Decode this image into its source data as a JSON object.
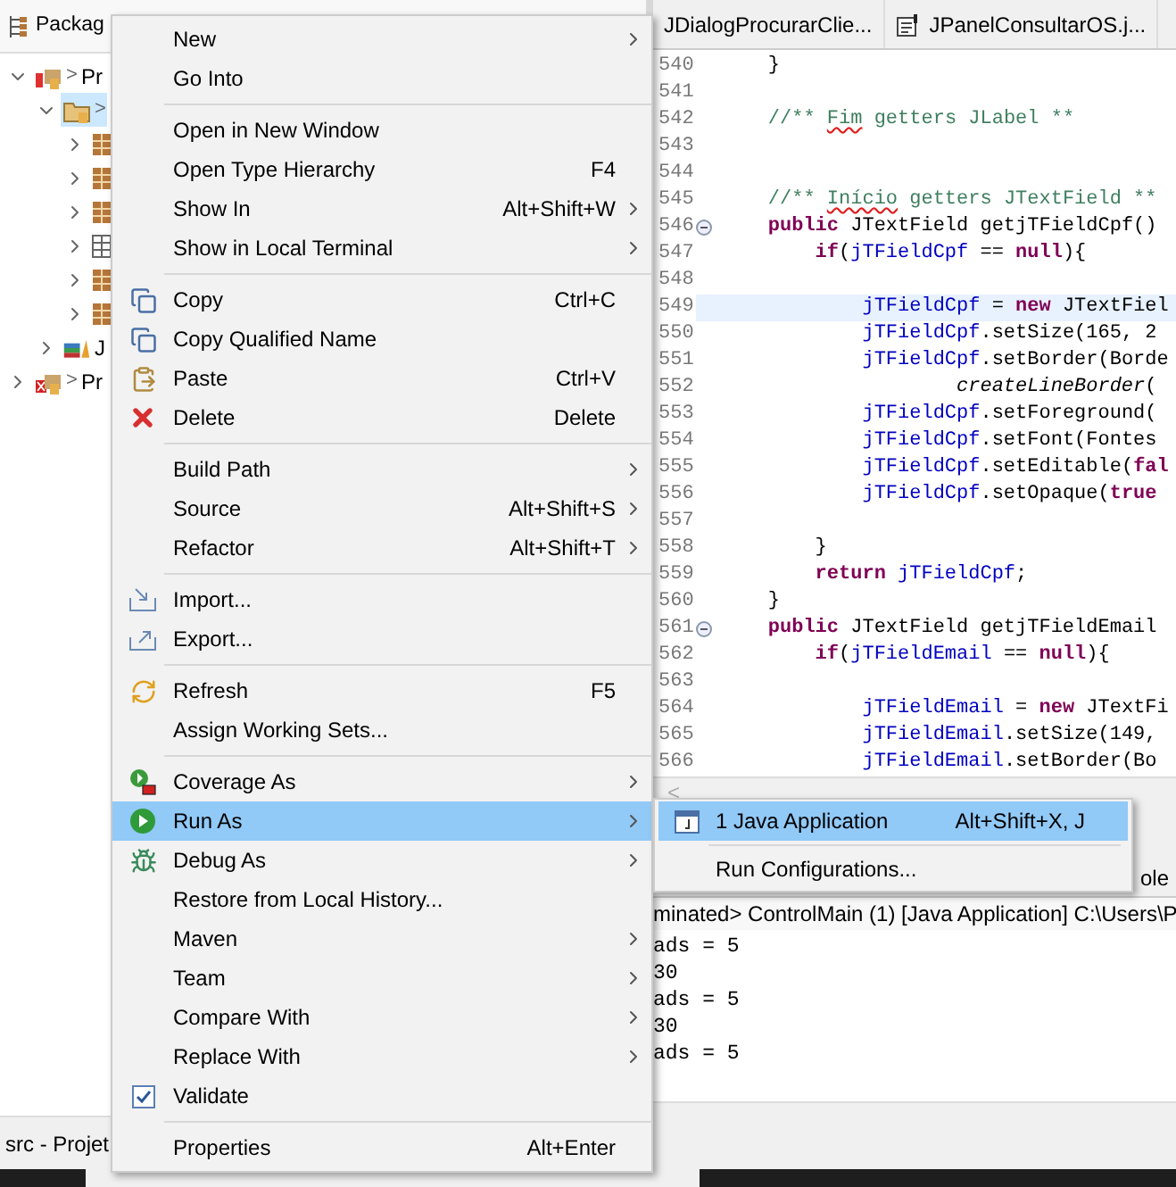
{
  "explorer": {
    "title": "Packag",
    "tree": [
      {
        "prefix": ">",
        "label": "Pr",
        "kind": "project",
        "selected": false,
        "expanded": true,
        "children": [
          {
            "prefix": ">",
            "kind": "package-root",
            "selected": true,
            "expanded": true,
            "children": [
              {
                "kind": "package",
                "selected": false,
                "expanded": false
              },
              {
                "kind": "package",
                "selected": false,
                "expanded": false
              },
              {
                "kind": "package",
                "selected": false,
                "expanded": false
              },
              {
                "kind": "empty-package",
                "selected": false,
                "expanded": false
              },
              {
                "kind": "package",
                "selected": false,
                "expanded": false
              },
              {
                "kind": "package",
                "selected": false,
                "expanded": false
              }
            ]
          },
          {
            "label": "J",
            "kind": "library",
            "selected": false,
            "expanded": false
          }
        ]
      },
      {
        "prefix": ">",
        "label": "Pr",
        "kind": "project-error",
        "selected": false,
        "expanded": false
      }
    ]
  },
  "status_bar": {
    "text": "src - Projet"
  },
  "editor": {
    "tabs": [
      {
        "label": "JDialogProcurarClie...",
        "selected": false
      },
      {
        "label": "JPanelConsultarOS.j...",
        "selected": false
      }
    ],
    "lines": [
      {
        "number": "540",
        "highlighted": false,
        "foldable": false,
        "tokens": [
          {
            "kind": "plain",
            "text": "    }"
          }
        ]
      },
      {
        "number": "541",
        "highlighted": false,
        "foldable": false
      },
      {
        "number": "542",
        "highlighted": false,
        "foldable": false,
        "tokens": [
          {
            "kind": "comment",
            "text": "    //** "
          },
          {
            "kind": "misspelled",
            "text": "Fim"
          },
          {
            "kind": "comment",
            "text": " getters JLabel **"
          }
        ]
      },
      {
        "number": "543",
        "highlighted": false,
        "foldable": false
      },
      {
        "number": "544",
        "highlighted": false,
        "foldable": false
      },
      {
        "number": "545",
        "highlighted": false,
        "foldable": false,
        "tokens": [
          {
            "kind": "comment",
            "text": "    //** "
          },
          {
            "kind": "misspelled",
            "text": "Início"
          },
          {
            "kind": "comment",
            "text": " getters JTextField **"
          }
        ]
      },
      {
        "number": "546",
        "highlighted": false,
        "foldable": true,
        "tokens": [
          {
            "kind": "keyword",
            "text": "    public"
          },
          {
            "kind": "plain",
            "text": " JTextField getjTFieldCpf()"
          }
        ]
      },
      {
        "number": "547",
        "highlighted": false,
        "foldable": false,
        "tokens": [
          {
            "kind": "keyword",
            "text": "        if"
          },
          {
            "kind": "plain",
            "text": "("
          },
          {
            "kind": "field",
            "text": "jTFieldCpf"
          },
          {
            "kind": "plain",
            "text": " == "
          },
          {
            "kind": "keyword",
            "text": "null"
          },
          {
            "kind": "plain",
            "text": "){"
          }
        ]
      },
      {
        "number": "548",
        "highlighted": false,
        "foldable": false
      },
      {
        "number": "549",
        "highlighted": true,
        "foldable": false,
        "tokens": [
          {
            "kind": "field",
            "text": "            jTFieldCpf"
          },
          {
            "kind": "plain",
            "text": " = "
          },
          {
            "kind": "keyword",
            "text": "new"
          },
          {
            "kind": "plain",
            "text": " JTextFiel"
          }
        ]
      },
      {
        "number": "550",
        "highlighted": false,
        "foldable": false,
        "tokens": [
          {
            "kind": "field",
            "text": "            jTFieldCpf"
          },
          {
            "kind": "plain",
            "text": ".setSize(165, 2"
          }
        ]
      },
      {
        "number": "551",
        "highlighted": false,
        "foldable": false,
        "tokens": [
          {
            "kind": "field",
            "text": "            jTFieldCpf"
          },
          {
            "kind": "plain",
            "text": ".setBorder(Borde"
          }
        ]
      },
      {
        "number": "552",
        "highlighted": false,
        "foldable": false,
        "tokens": [
          {
            "kind": "static",
            "text": "                    createLineBorder"
          },
          {
            "kind": "plain",
            "text": "("
          }
        ]
      },
      {
        "number": "553",
        "highlighted": false,
        "foldable": false,
        "tokens": [
          {
            "kind": "field",
            "text": "            jTFieldCpf"
          },
          {
            "kind": "plain",
            "text": ".setForeground("
          }
        ]
      },
      {
        "number": "554",
        "highlighted": false,
        "foldable": false,
        "tokens": [
          {
            "kind": "field",
            "text": "            jTFieldCpf"
          },
          {
            "kind": "plain",
            "text": ".setFont(Fontes"
          }
        ]
      },
      {
        "number": "555",
        "highlighted": false,
        "foldable": false,
        "tokens": [
          {
            "kind": "field",
            "text": "            jTFieldCpf"
          },
          {
            "kind": "plain",
            "text": ".setEditable("
          },
          {
            "kind": "keyword",
            "text": "fal"
          }
        ]
      },
      {
        "number": "556",
        "highlighted": false,
        "foldable": false,
        "tokens": [
          {
            "kind": "field",
            "text": "            jTFieldCpf"
          },
          {
            "kind": "plain",
            "text": ".setOpaque("
          },
          {
            "kind": "keyword",
            "text": "true"
          }
        ]
      },
      {
        "number": "557",
        "highlighted": false,
        "foldable": false
      },
      {
        "number": "558",
        "highlighted": false,
        "foldable": false,
        "tokens": [
          {
            "kind": "plain",
            "text": "        }"
          }
        ]
      },
      {
        "number": "559",
        "highlighted": false,
        "foldable": false,
        "tokens": [
          {
            "kind": "keyword",
            "text": "        return"
          },
          {
            "kind": "field",
            "text": " jTFieldCpf"
          },
          {
            "kind": "plain",
            "text": ";"
          }
        ]
      },
      {
        "number": "560",
        "highlighted": false,
        "foldable": false,
        "tokens": [
          {
            "kind": "plain",
            "text": "    }"
          }
        ]
      },
      {
        "number": "561",
        "highlighted": false,
        "foldable": true,
        "tokens": [
          {
            "kind": "keyword",
            "text": "    public"
          },
          {
            "kind": "plain",
            "text": " JTextField getjTFieldEmail"
          }
        ]
      },
      {
        "number": "562",
        "highlighted": false,
        "foldable": false,
        "tokens": [
          {
            "kind": "keyword",
            "text": "        if"
          },
          {
            "kind": "plain",
            "text": "("
          },
          {
            "kind": "field",
            "text": "jTFieldEmail"
          },
          {
            "kind": "plain",
            "text": " == "
          },
          {
            "kind": "keyword",
            "text": "null"
          },
          {
            "kind": "plain",
            "text": "){"
          }
        ]
      },
      {
        "number": "563",
        "highlighted": false,
        "foldable": false
      },
      {
        "number": "564",
        "highlighted": false,
        "foldable": false,
        "tokens": [
          {
            "kind": "field",
            "text": "            jTFieldEmail"
          },
          {
            "kind": "plain",
            "text": " = "
          },
          {
            "kind": "keyword",
            "text": "new"
          },
          {
            "kind": "plain",
            "text": " JTextFi"
          }
        ]
      },
      {
        "number": "565",
        "highlighted": false,
        "foldable": false,
        "tokens": [
          {
            "kind": "field",
            "text": "            jTFieldEmail"
          },
          {
            "kind": "plain",
            "text": ".setSize(149,"
          }
        ]
      },
      {
        "number": "566",
        "highlighted": false,
        "foldable": false,
        "tokens": [
          {
            "kind": "field",
            "text": "            jTFieldEmail"
          },
          {
            "kind": "plain",
            "text": ".setBorder(Bo"
          }
        ]
      }
    ],
    "scroll_left": "<"
  },
  "console": {
    "tab": "ole",
    "header": "minated> ControlMain (1) [Java Application] C:\\Users\\P",
    "lines": [
      "ads = 5",
      "30",
      "ads = 5",
      "30",
      "ads = 5"
    ]
  },
  "context_menu": {
    "items": [
      {
        "kind": "item",
        "label": "New",
        "submenu": true,
        "selected": false
      },
      {
        "kind": "item",
        "label": "Go Into",
        "submenu": false,
        "selected": false
      },
      {
        "kind": "separator"
      },
      {
        "kind": "item",
        "label": "Open in New Window",
        "submenu": false,
        "selected": false
      },
      {
        "kind": "item",
        "label": "Open Type Hierarchy",
        "shortcut": "F4",
        "submenu": false,
        "selected": false
      },
      {
        "kind": "item",
        "label": "Show In",
        "shortcut": "Alt+Shift+W",
        "submenu": true,
        "selected": false
      },
      {
        "kind": "item",
        "label": "Show in Local Terminal",
        "submenu": true,
        "selected": false
      },
      {
        "kind": "separator"
      },
      {
        "kind": "item",
        "label": "Copy",
        "shortcut": "Ctrl+C",
        "submenu": false,
        "selected": false
      },
      {
        "kind": "item",
        "label": "Copy Qualified Name",
        "submenu": false,
        "selected": false
      },
      {
        "kind": "item",
        "label": "Paste",
        "shortcut": "Ctrl+V",
        "submenu": false,
        "selected": false
      },
      {
        "kind": "item",
        "label": "Delete",
        "shortcut": "Delete",
        "submenu": false,
        "selected": false
      },
      {
        "kind": "separator"
      },
      {
        "kind": "item",
        "label": "Build Path",
        "submenu": true,
        "selected": false
      },
      {
        "kind": "item",
        "label": "Source",
        "shortcut": "Alt+Shift+S",
        "submenu": true,
        "selected": false
      },
      {
        "kind": "item",
        "label": "Refactor",
        "shortcut": "Alt+Shift+T",
        "submenu": true,
        "selected": false
      },
      {
        "kind": "separator"
      },
      {
        "kind": "item",
        "label": "Import...",
        "submenu": false,
        "selected": false
      },
      {
        "kind": "item",
        "label": "Export...",
        "submenu": false,
        "selected": false
      },
      {
        "kind": "separator"
      },
      {
        "kind": "item",
        "label": "Refresh",
        "shortcut": "F5",
        "submenu": false,
        "selected": false
      },
      {
        "kind": "item",
        "label": "Assign Working Sets...",
        "submenu": false,
        "selected": false
      },
      {
        "kind": "separator"
      },
      {
        "kind": "item",
        "label": "Coverage As",
        "submenu": true,
        "selected": false
      },
      {
        "kind": "item",
        "label": "Run As",
        "submenu": true,
        "selected": true
      },
      {
        "kind": "item",
        "label": "Debug As",
        "submenu": true,
        "selected": false
      },
      {
        "kind": "item",
        "label": "Restore from Local History...",
        "submenu": false,
        "selected": false
      },
      {
        "kind": "item",
        "label": "Maven",
        "submenu": true,
        "selected": false
      },
      {
        "kind": "item",
        "label": "Team",
        "submenu": true,
        "selected": false
      },
      {
        "kind": "item",
        "label": "Compare With",
        "submenu": true,
        "selected": false
      },
      {
        "kind": "item",
        "label": "Replace With",
        "submenu": true,
        "selected": false
      },
      {
        "kind": "check",
        "label": "Validate",
        "checked": true,
        "submenu": false,
        "selected": false
      },
      {
        "kind": "separator"
      },
      {
        "kind": "item",
        "label": "Properties",
        "shortcut": "Alt+Enter",
        "submenu": false,
        "selected": false
      }
    ]
  },
  "run_as_submenu": {
    "items": [
      {
        "kind": "item",
        "label": "1 Java Application",
        "shortcut": "Alt+Shift+X, J",
        "selected": true
      },
      {
        "kind": "separator"
      },
      {
        "kind": "item",
        "label": "Run Configurations...",
        "selected": false
      }
    ]
  }
}
